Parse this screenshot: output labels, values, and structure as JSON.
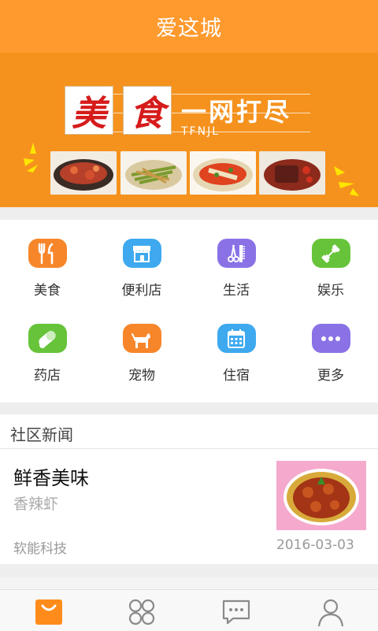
{
  "app": {
    "title": "爱这城"
  },
  "banner": {
    "char1": "美",
    "char2": "食",
    "slogan": "一网打尽",
    "subtitle": "TFNJL"
  },
  "categories": [
    {
      "label": "美食",
      "icon": "knife-fork-icon",
      "color": "#f7862a"
    },
    {
      "label": "便利店",
      "icon": "store-icon",
      "color": "#3ea9ef"
    },
    {
      "label": "生活",
      "icon": "scissors-comb-icon",
      "color": "#8a72e6"
    },
    {
      "label": "娱乐",
      "icon": "dumbbell-icon",
      "color": "#67c43a"
    },
    {
      "label": "药店",
      "icon": "pill-icon",
      "color": "#67c43a"
    },
    {
      "label": "宠物",
      "icon": "dog-icon",
      "color": "#f7862a"
    },
    {
      "label": "住宿",
      "icon": "calendar-icon",
      "color": "#3ea9ef"
    },
    {
      "label": "更多",
      "icon": "more-icon",
      "color": "#8a72e6"
    }
  ],
  "news": {
    "section_title": "社区新闻",
    "items": [
      {
        "title": "鲜香美味",
        "subtitle": "香辣虾",
        "source": "软能科技",
        "date": "2016-03-03"
      }
    ]
  },
  "tabbar": {
    "active_color": "#ff8c1a",
    "items": [
      {
        "icon": "shopping-bag-icon"
      },
      {
        "icon": "grid-apps-icon"
      },
      {
        "icon": "message-icon"
      },
      {
        "icon": "user-icon"
      }
    ]
  }
}
